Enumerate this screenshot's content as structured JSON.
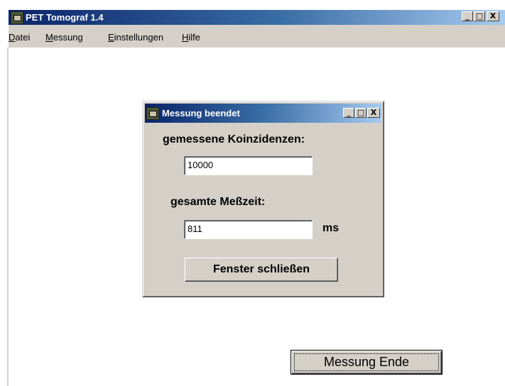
{
  "main_window": {
    "title": "PET Tomograf 1.4",
    "caption_buttons": [
      "_",
      "□",
      "X"
    ],
    "menu": [
      {
        "label": "Datei",
        "mnemonic": "D",
        "rest": "atei"
      },
      {
        "label": "Messung",
        "mnemonic": "M",
        "rest": "essung"
      },
      {
        "label": "Einstellungen",
        "mnemonic": "E",
        "rest": "instellungen"
      },
      {
        "label": "Hilfe",
        "mnemonic": "H",
        "rest": "ilfe"
      }
    ],
    "end_button": "Messung Ende"
  },
  "dialog": {
    "title": "Messung beendet",
    "caption_buttons": [
      "_",
      "□",
      "X"
    ],
    "coincidences_label": "gemessene Koinzidenzen:",
    "coincidences_value": "10000",
    "time_label": "gesamte Meßzeit:",
    "time_value": "811",
    "time_unit": "ms",
    "close_button": "Fenster schließen"
  },
  "colors": {
    "titlebar_start": "#0a246a",
    "titlebar_end": "#a6caf0",
    "face": "#d4d0c8"
  }
}
